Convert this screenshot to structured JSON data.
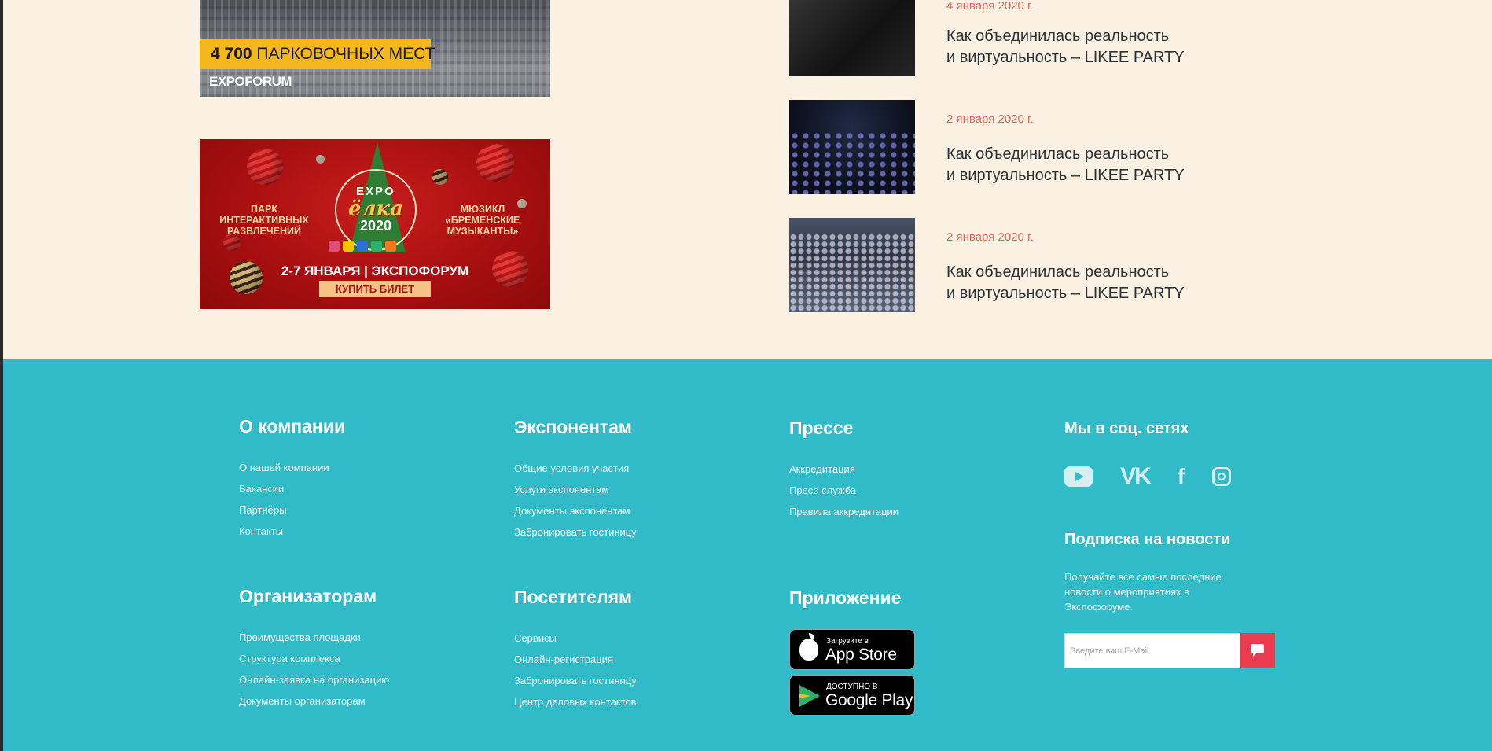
{
  "banners": {
    "parking": {
      "tag_number": "4 700",
      "tag_text": "ПАРКОВОЧНЫХ МЕСТ",
      "brand": "EXPOFORUM"
    },
    "xmas": {
      "left_text": "ПАРК\nИНТЕРАКТИВНЫХ\nРАЗВЛЕЧЕНИЙ",
      "logo_top": "EXPO",
      "logo_main": "ёлка",
      "logo_year": "2020",
      "right_text": "МЮЗИКЛ\n«БРЕМЕНСКИЕ\nМУЗЫКАНТЫ»",
      "date": "2-7 ЯНВАРЯ | ЭКСПОФОРУМ",
      "buy": "КУПИТЬ БИЛЕТ"
    }
  },
  "news": [
    {
      "date": "4 января 2020 г.",
      "title_line1": "Как объединилась реальность",
      "title_line2": "и виртуальность – LIKEE PARTY"
    },
    {
      "date": "2 января 2020 г.",
      "title_line1": "Как объединилась реальность",
      "title_line2": "и виртуальность – LIKEE PARTY"
    },
    {
      "date": "2 января 2020 г.",
      "title_line1": "Как объединилась реальность",
      "title_line2": "и виртуальность – LIKEE PARTY"
    }
  ],
  "footer": {
    "company": {
      "title": "О компании",
      "links": [
        "О нашей компании",
        "Вакансии",
        "Партнёры",
        "Контакты"
      ]
    },
    "exhibitors": {
      "title": "Экспонентам",
      "links": [
        "Общие условия участия",
        "Услуги экспонентам",
        "Документы экспонентам",
        "Забронировать гостиницу"
      ]
    },
    "press": {
      "title": "Прессе",
      "links": [
        "Аккредитация",
        "Пресс-служба",
        "Правила аккредитации"
      ]
    },
    "social": {
      "title": "Мы в соц. сетях",
      "icons": [
        "youtube-icon",
        "vk-icon",
        "facebook-icon",
        "instagram-icon"
      ],
      "vk": "VK",
      "fb": "f"
    },
    "organizers": {
      "title": "Организаторам",
      "links": [
        "Преимущества площадки",
        "Структура комплекса",
        "Онлайн-заявка на организацию",
        "Документы организаторам"
      ]
    },
    "visitors": {
      "title": "Посетителям",
      "links": [
        "Сервисы",
        "Онлайн-регистрация",
        "Забронировать гостиницу",
        "Центр деловых контактов"
      ]
    },
    "app": {
      "title": "Приложение",
      "appstore_small": "Загрузите в",
      "appstore_big": "App Store",
      "googleplay_small": "ДОСТУПНО В",
      "googleplay_big": "Google Play"
    },
    "subscribe": {
      "title": "Подписка на новости",
      "text": "Получайте все самые последние новости о мероприятиях в Экспофоруме.",
      "placeholder": "Введите ваш E-Mail"
    }
  },
  "colors": {
    "page_bg": "#faf1e2",
    "footer_bg": "#31bbc9",
    "accent_red": "#ea3b4f",
    "date_color": "#e06b5d"
  }
}
